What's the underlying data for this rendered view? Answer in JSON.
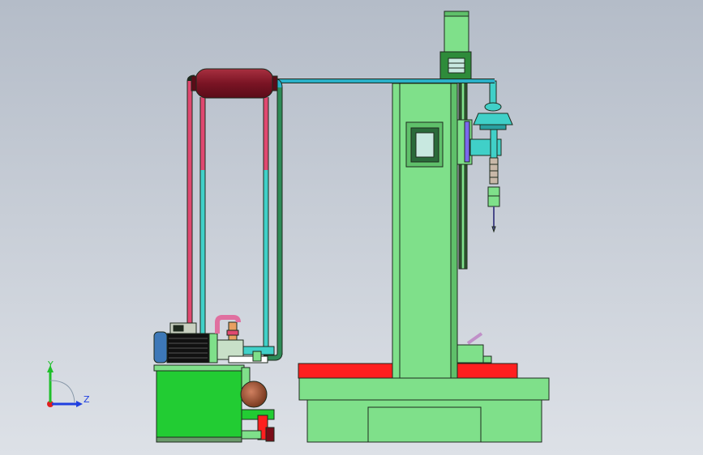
{
  "viewport": {
    "background_top": "#b4bcc8",
    "background_bottom": "#dde1e7"
  },
  "colors": {
    "machine_green": "#7fe08a",
    "outline": "#1e2a1e",
    "red": "#ff1f1f",
    "maroon": "#8b1a2a",
    "teal": "#40d0c8",
    "cyan_pipe": "#2ab0c8",
    "pink_pipe": "#e04870",
    "dark_green_pipe": "#2e8b57",
    "motor_blue": "#3d78b8",
    "pump_brown": "#a0522d",
    "violet": "#7b68ee"
  },
  "triad": {
    "y_label": "Y",
    "z_label": "Z",
    "y_color": "#1fbf2a",
    "z_color": "#1f3fe0",
    "x_color": "#e01f1f"
  }
}
